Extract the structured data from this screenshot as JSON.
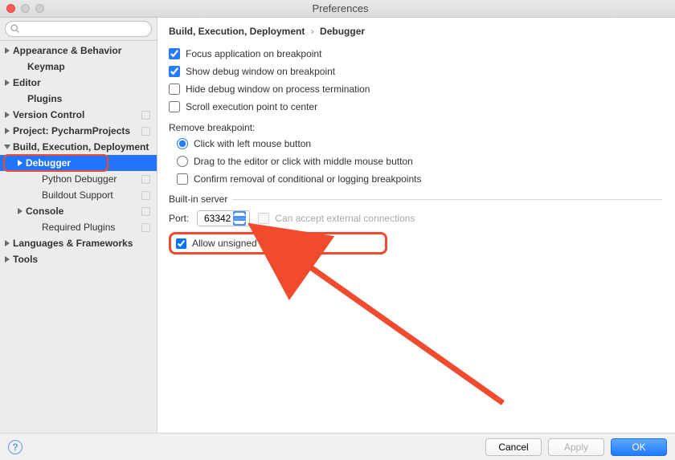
{
  "window": {
    "title": "Preferences"
  },
  "search": {
    "placeholder": ""
  },
  "sidebar": {
    "items": [
      {
        "label": "Appearance & Behavior",
        "depth": 0,
        "expand": true,
        "open": false
      },
      {
        "label": "Keymap",
        "depth": 1,
        "expand": false
      },
      {
        "label": "Editor",
        "depth": 0,
        "expand": true,
        "open": false
      },
      {
        "label": "Plugins",
        "depth": 1,
        "expand": false
      },
      {
        "label": "Version Control",
        "depth": 0,
        "expand": true,
        "open": false,
        "modified": true
      },
      {
        "label": "Project: PycharmProjects",
        "depth": 0,
        "expand": true,
        "open": false,
        "modified": true
      },
      {
        "label": "Build, Execution, Deployment",
        "depth": 0,
        "expand": true,
        "open": true
      },
      {
        "label": "Debugger",
        "depth": 1,
        "expand": true,
        "open": false,
        "selected": true,
        "highlighted": true
      },
      {
        "label": "Python Debugger",
        "depth": 2,
        "expand": false,
        "modified": true
      },
      {
        "label": "Buildout Support",
        "depth": 2,
        "expand": false,
        "modified": true
      },
      {
        "label": "Console",
        "depth": 1,
        "expand": true,
        "open": false,
        "modified": true
      },
      {
        "label": "Required Plugins",
        "depth": 2,
        "expand": false,
        "modified": true
      },
      {
        "label": "Languages & Frameworks",
        "depth": 0,
        "expand": true,
        "open": false
      },
      {
        "label": "Tools",
        "depth": 0,
        "expand": true,
        "open": false
      }
    ]
  },
  "breadcrumb": {
    "a": "Build, Execution, Deployment",
    "b": "Debugger"
  },
  "checks": {
    "focus": "Focus application on breakpoint",
    "show": "Show debug window on breakpoint",
    "hide": "Hide debug window on process termination",
    "scroll": "Scroll execution point to center"
  },
  "remove": {
    "label": "Remove breakpoint:",
    "click": "Click with left mouse button",
    "drag": "Drag to the editor or click with middle mouse button",
    "confirm": "Confirm removal of conditional or logging breakpoints"
  },
  "server": {
    "legend": "Built-in server",
    "portLabel": "Port:",
    "port": "63342",
    "accept": "Can accept external connections",
    "allow": "Allow unsigned requests"
  },
  "buttons": {
    "cancel": "Cancel",
    "apply": "Apply",
    "ok": "OK"
  }
}
